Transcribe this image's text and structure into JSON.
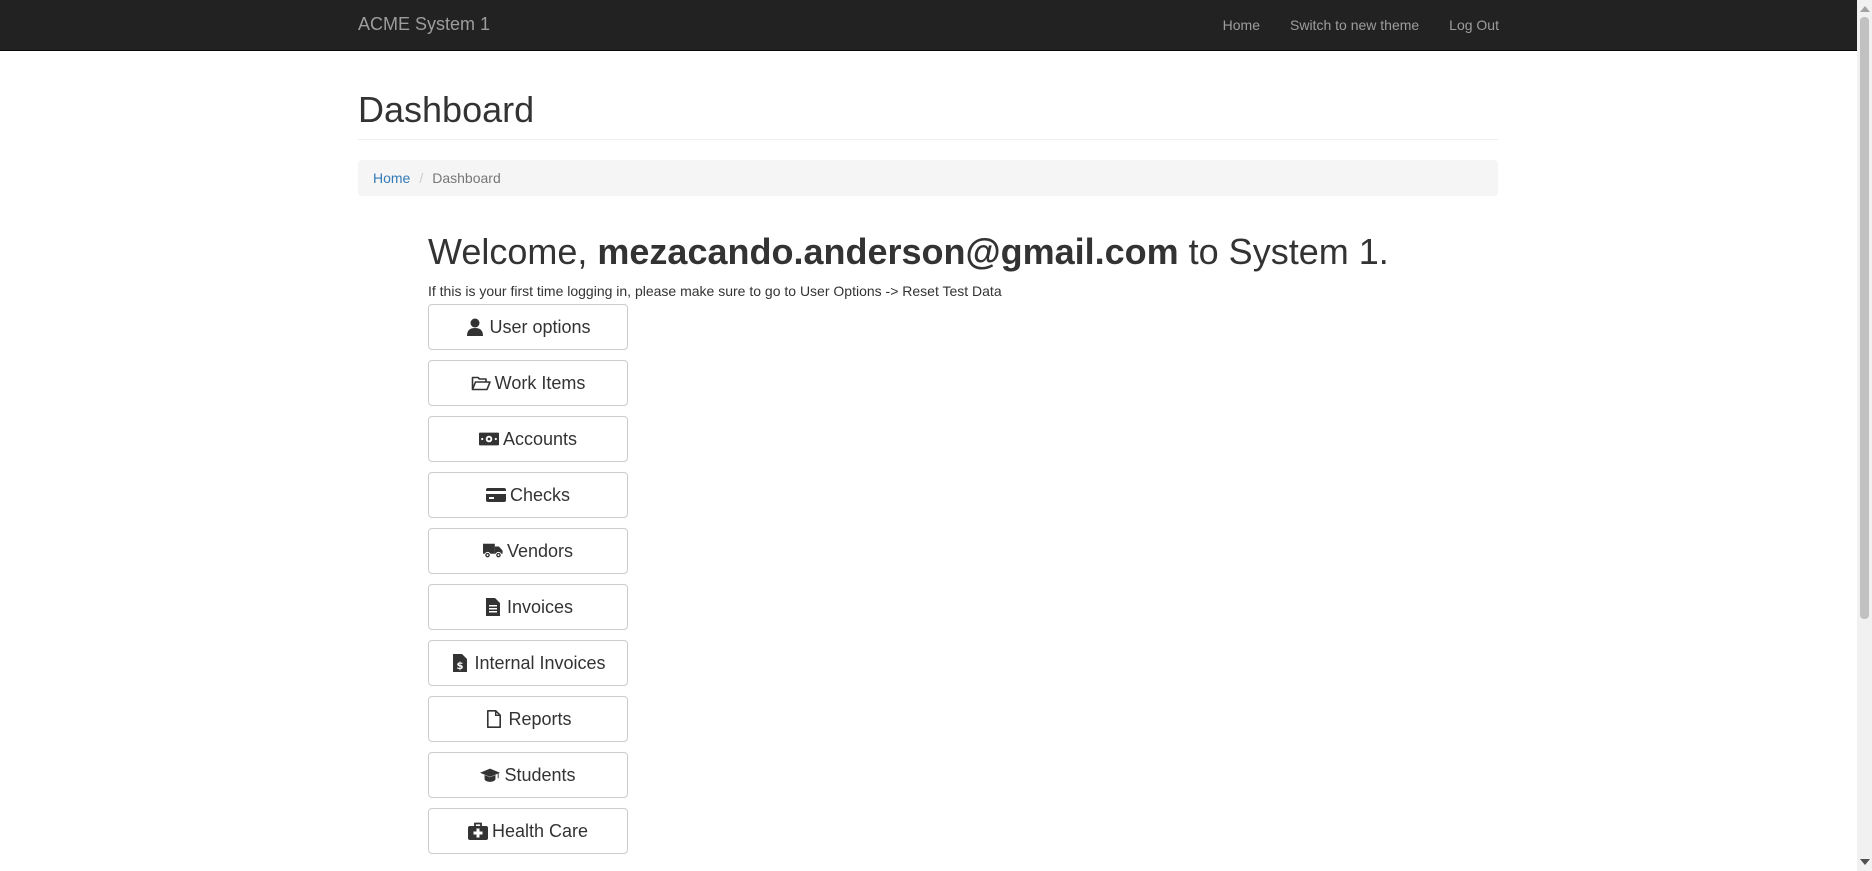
{
  "navbar": {
    "brand": "ACME System 1",
    "links": [
      "Home",
      "Switch to new theme",
      "Log Out"
    ]
  },
  "page": {
    "title": "Dashboard"
  },
  "breadcrumb": {
    "home": "Home",
    "separator": "/",
    "current": "Dashboard"
  },
  "welcome": {
    "prefix": "Welcome, ",
    "user": "mezacando.anderson@gmail.com",
    "suffix": " to System 1.",
    "hint": "If this is your first time logging in, please make sure to go to User Options -> Reset Test Data"
  },
  "menu": [
    {
      "label": "User options",
      "icon": "user-icon"
    },
    {
      "label": "Work Items",
      "icon": "folder-open-icon"
    },
    {
      "label": "Accounts",
      "icon": "money-icon"
    },
    {
      "label": "Checks",
      "icon": "credit-card-icon"
    },
    {
      "label": "Vendors",
      "icon": "truck-icon"
    },
    {
      "label": "Invoices",
      "icon": "file-text-icon"
    },
    {
      "label": "Internal Invoices",
      "icon": "file-invoice-dollar-icon"
    },
    {
      "label": "Reports",
      "icon": "file-icon"
    },
    {
      "label": "Students",
      "icon": "graduation-cap-icon"
    },
    {
      "label": "Health Care",
      "icon": "medkit-icon"
    }
  ],
  "colors": {
    "navbar_bg": "#222222",
    "navbar_text": "#9d9d9d",
    "link": "#337ab7",
    "breadcrumb_bg": "#f5f5f5"
  }
}
